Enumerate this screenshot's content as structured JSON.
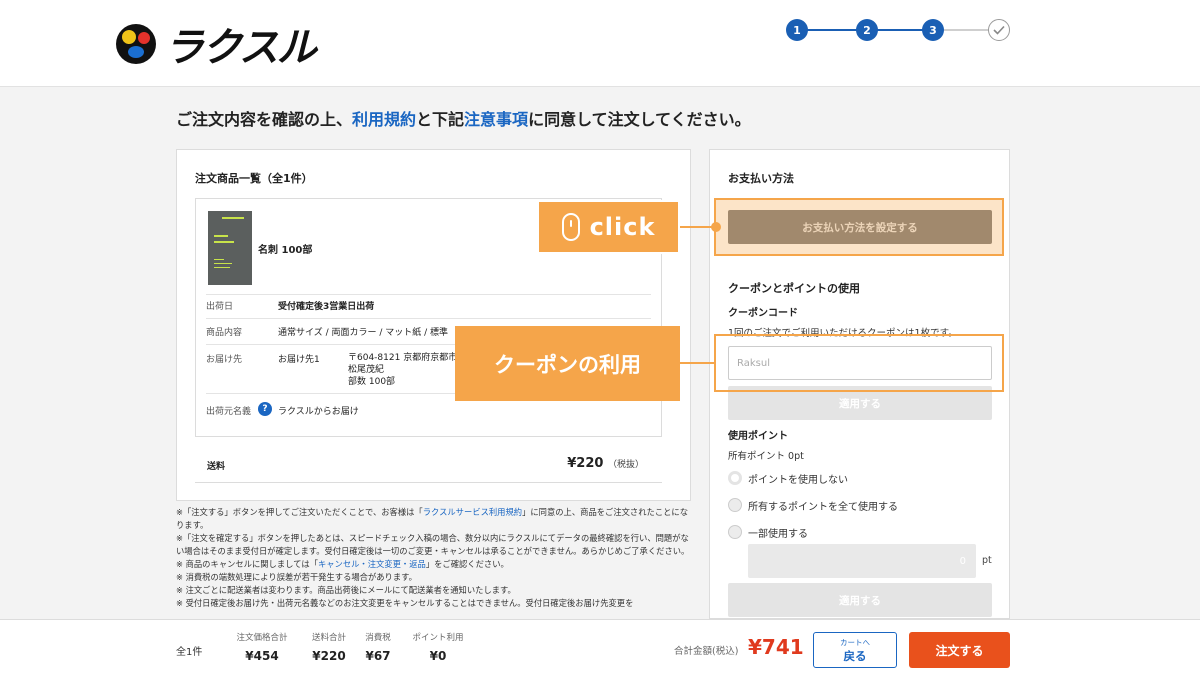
{
  "header": {
    "logo_text": "ラクスル",
    "steps": [
      "1",
      "2",
      "3"
    ],
    "step_done_icon": "checkmark-icon"
  },
  "title": {
    "pre": "ご注文内容を確認の上、",
    "terms_link": "利用規約",
    "mid": "と下記",
    "notes_link": "注意事項",
    "post": "に同意して注文してください。"
  },
  "order_items": {
    "heading": "注文商品一覧（全1件）",
    "product_name": "名刺 100部",
    "rows": {
      "ship_date_label": "出荷日",
      "ship_date_value": "受付確定後3営業日出荷",
      "content_label": "商品内容",
      "content_value": "通常サイズ / 両面カラー / マット紙 / 標準",
      "deliver_label": "お届け先",
      "deliver_name": "お届け先1",
      "addr_line1": "〒604-8121 京都府京都市",
      "addr_line2": "松尾茂紀",
      "addr_line3": "部数 100部",
      "sender_label": "出荷元名義",
      "sender_value": "ラクスルからお届け"
    },
    "shipping_label": "送料",
    "shipping_price": "¥220",
    "shipping_note": "（税抜）"
  },
  "notes": {
    "line1_pre": "※「注文する」ボタンを押してご注文いただくことで、お客様は「",
    "line1_link": "ラクスルサービス利用規約",
    "line1_post": "」に同意の上、商品をご注文されたことになります。",
    "line2": "※「注文を確定する」ボタンを押したあとは、スピードチェック入稿の場合、数分以内にラクスルにてデータの最終確認を行い、問題がない場合はそのまま受付日が確定します。受付日確定後は一切のご変更・キャンセルは承ることができません。あらかじめご了承ください。",
    "line3_pre": "※ 商品のキャンセルに関しましては「",
    "line3_link": "キャンセル・注文変更・返品",
    "line3_post": "」をご確認ください。",
    "line4": "※ 消費税の端数処理により誤差が若干発生する場合があります。",
    "line5": "※ 注文ごとに配送業者は変わります。商品出荷後にメールにて配送業者を通知いたします。",
    "line6": "※ 受付日確定後お届け先・出荷元名義などのお注文変更をキャンセルすることはできません。受付日確定後お届け先変更を"
  },
  "payment": {
    "heading": "お支払い方法",
    "set_button": "お支払い方法を設定する"
  },
  "coupon": {
    "heading": "クーポンとポイントの使用",
    "code_label": "クーポンコード",
    "hint": "1回のご注文でご利用いただけるクーポンは1枚です。",
    "placeholder": "Raksul",
    "apply_button": "適用する"
  },
  "points": {
    "heading": "使用ポイント",
    "owned": "所有ポイント 0pt",
    "opt_none": "ポイントを使用しない",
    "opt_all": "所有するポイントを全て使用する",
    "opt_part": "一部使用する",
    "input_value": "0",
    "unit": "pt",
    "apply_button": "適用する"
  },
  "annotations": {
    "click_label": "click",
    "coupon_label": "クーポンの利用"
  },
  "footer": {
    "count": "全1件",
    "cols": [
      {
        "label": "注文価格合計",
        "value": "¥454"
      },
      {
        "label": "送料合計",
        "value": "¥220"
      },
      {
        "label": "消費税",
        "value": "¥67"
      },
      {
        "label": "ポイント利用",
        "value": "¥0"
      }
    ],
    "total_label": "合計金額(税込)",
    "total_value": "¥741",
    "back_small": "カートへ",
    "back_big": "戻る",
    "order_button": "注文する"
  },
  "colors": {
    "brand_blue": "#1a5fb4",
    "link_blue": "#1a66c2",
    "annotation_orange": "#f5a54a",
    "order_orange": "#e9511c",
    "total_red": "#e03a1e"
  }
}
